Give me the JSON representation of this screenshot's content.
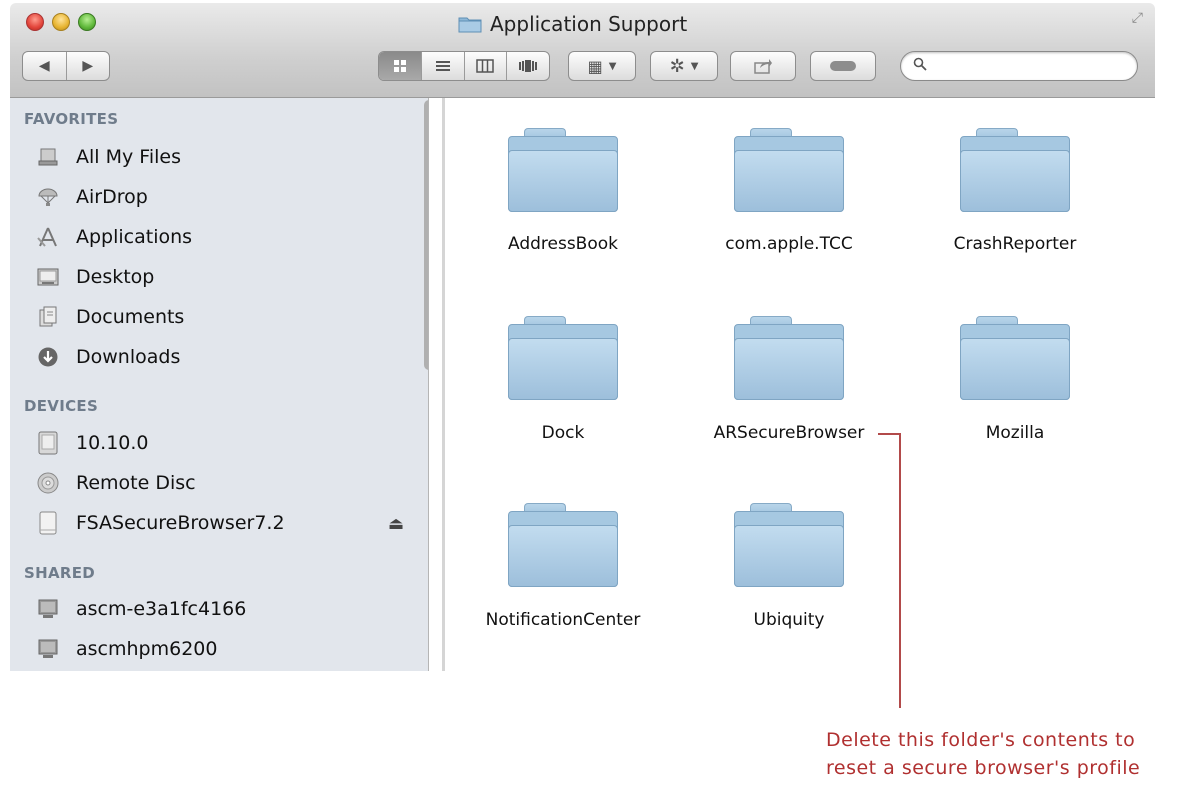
{
  "window": {
    "title": "Application Support"
  },
  "sidebar": {
    "favorites_header": "FAVORITES",
    "favorites": [
      {
        "label": "All My Files",
        "icon": "all-files-icon"
      },
      {
        "label": "AirDrop",
        "icon": "airdrop-icon"
      },
      {
        "label": "Applications",
        "icon": "applications-icon"
      },
      {
        "label": "Desktop",
        "icon": "desktop-icon"
      },
      {
        "label": "Documents",
        "icon": "documents-icon"
      },
      {
        "label": "Downloads",
        "icon": "downloads-icon"
      }
    ],
    "devices_header": "DEVICES",
    "devices": [
      {
        "label": "10.10.0",
        "icon": "hard-drive-icon"
      },
      {
        "label": "Remote Disc",
        "icon": "disc-icon"
      },
      {
        "label": "FSASecureBrowser7.2",
        "icon": "volume-icon"
      }
    ],
    "shared_header": "SHARED",
    "shared": [
      {
        "label": "ascm-e3a1fc4166",
        "icon": "network-computer-icon"
      },
      {
        "label": "ascmhpm6200",
        "icon": "network-computer-icon"
      }
    ]
  },
  "folders": [
    {
      "label": "AddressBook"
    },
    {
      "label": "com.apple.TCC"
    },
    {
      "label": "CrashReporter"
    },
    {
      "label": "Dock"
    },
    {
      "label": "ARSecureBrowser"
    },
    {
      "label": "Mozilla"
    },
    {
      "label": "NotificationCenter"
    },
    {
      "label": "Ubiquity"
    }
  ],
  "annotation": {
    "line1": "Delete this folder's contents to",
    "line2": "reset a secure browser's profile",
    "color": "#b03030"
  },
  "search": {
    "placeholder": ""
  }
}
